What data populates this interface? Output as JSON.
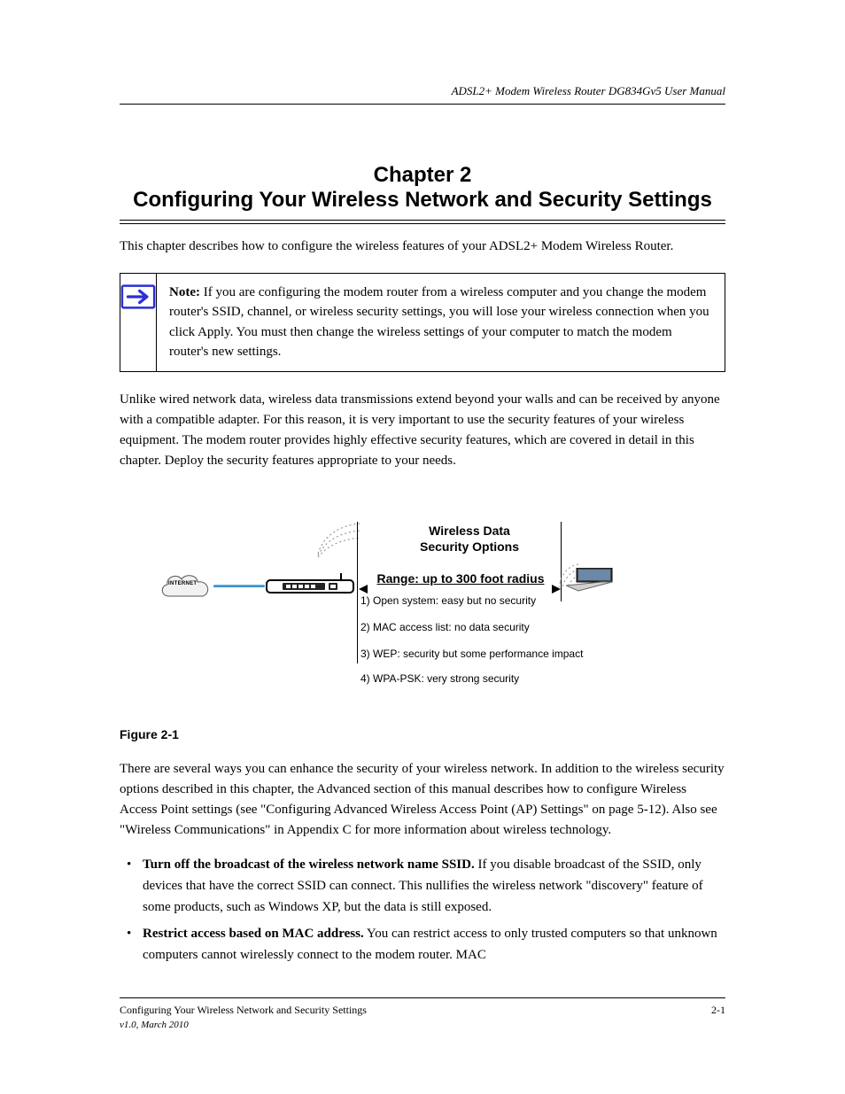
{
  "header": {
    "left": "",
    "right": "ADSL2+ Modem Wireless Router DG834Gv5 User Manual"
  },
  "chapter": {
    "title": "Chapter 2 \nConfiguring Your Wireless Network and Security Settings"
  },
  "intro": "This chapter describes how to configure the wireless features of your ADSL2+ Modem Wireless Router.",
  "note": {
    "label": "Note:",
    "text": " If you are configuring the modem router from a wireless computer and you change the modem router's SSID, channel, or wireless security settings, you will lose your wireless connection when you click Apply. You must then change the wireless settings of your computer to match the modem router's new settings."
  },
  "para1": "Unlike wired network data, wireless data transmissions extend beyond your walls and can be received by anyone with a compatible adapter. For this reason, it is very important to use the security features of your wireless equipment. The modem router provides highly effective security features, which are covered in detail in this chapter. Deploy the security features appropriate to your needs.",
  "figure": {
    "internet_label": "INTERNET",
    "wd_title1": "Wireless Data",
    "wd_title2": "Security Options",
    "range": "Range: up to 300 foot radius",
    "item1": "1) Open system: easy but no security",
    "item2": "2) MAC access list: no data security",
    "item3": "3) WEP: security but some performance impact",
    "item4": "4) WPA-PSK: very strong security",
    "caption": "Figure 2-1"
  },
  "para2a": "There are several ways you can enhance the security of your wireless network. In addition to the wireless security options described in this chapter, the Advanced section of this manual describes how to configure Wireless Access Point settings (see ",
  "para2link": "\"Configuring Advanced Wireless Access Point (AP) Settings\" on page 5-12",
  "para2b": "). Also see ",
  "para2link2": "\"Wireless Communications\" in Appendix C",
  "para2c": " for more information about wireless technology.",
  "bullets": {
    "b1a": "Turn off the broadcast of the wireless network name SSID.",
    "b1b": " If you disable broadcast of the SSID, only devices that have the correct SSID can connect. This nullifies the wireless network \"discovery\" feature of some products, such as Windows XP, but the data is still exposed.",
    "b2a": "Restrict access based on MAC address.",
    "b2b": " You can restrict access to only trusted computers so that unknown computers cannot wirelessly connect to the modem router. MAC"
  },
  "footer": {
    "left": "Configuring Your Wireless Network and Security Settings",
    "right": "2-1",
    "version": "v1.0, March 2010"
  }
}
